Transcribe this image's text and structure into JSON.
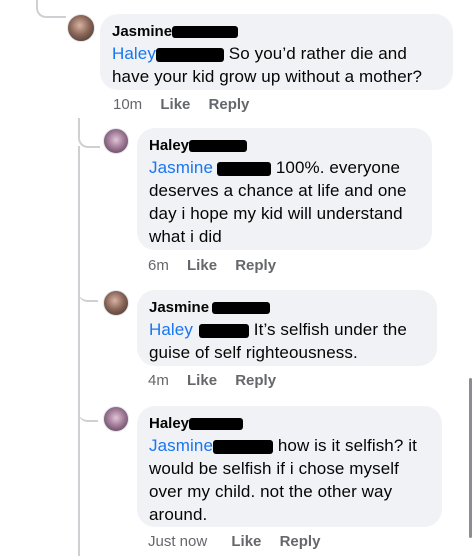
{
  "comments": [
    {
      "author": "Jasmine",
      "mention": "Haley",
      "text_after": " So you’d rather die and",
      "text_line2": "have your kid grow up without a mother?",
      "time": "10m",
      "like": "Like",
      "reply": "Reply"
    },
    {
      "author": "Haley",
      "mention": "Jasmine",
      "text_after": " 100%. everyone",
      "text_line2": "deserves a chance at life and one",
      "text_line3": "day i hope my kid will understand",
      "text_line4": "what i did",
      "time": "6m",
      "like": "Like",
      "reply": "Reply"
    },
    {
      "author": "Jasmine",
      "mention": "Haley",
      "text_after": " It’s selfish under the",
      "text_line2": "guise of self righteousness.",
      "time": "4m",
      "like": "Like",
      "reply": "Reply"
    },
    {
      "author": "Haley",
      "mention": "Jasmine",
      "text_after": " how is it selfish? it",
      "text_line2": "would be selfish if i chose myself",
      "text_line3": "over my child. not the other way",
      "text_line4": "around.",
      "time": "Just now",
      "like": "Like",
      "reply": "Reply"
    }
  ]
}
